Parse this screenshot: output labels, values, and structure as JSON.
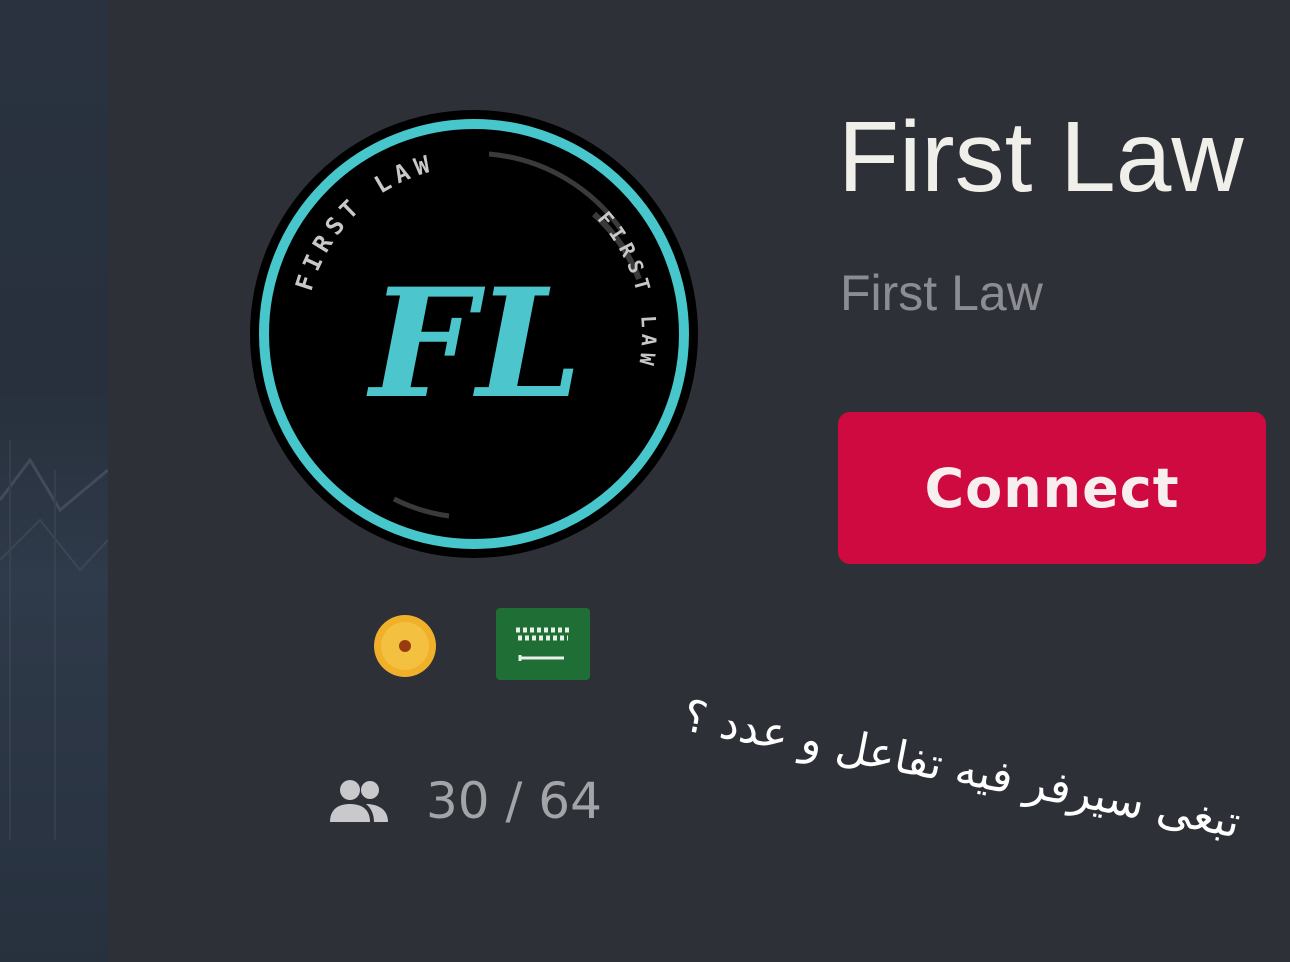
{
  "server": {
    "title": "First Law",
    "subtitle": "First Law",
    "logo_text": "FL",
    "logo_ring_text": "FIRST LAW"
  },
  "actions": {
    "connect_label": "Connect"
  },
  "badges": {
    "coin_icon": "gold-coin-icon",
    "flag_icon": "saudi-flag-icon"
  },
  "players": {
    "icon": "players-icon",
    "count": "30 / 64"
  },
  "caption": {
    "text": "تبغى سيرفر فيه تفاعل و عدد ؟"
  },
  "colors": {
    "background": "#2e3037",
    "accent": "#cf0a41",
    "logo_ring": "#47c6cc",
    "title": "#f1efea",
    "subtitle": "#8b8d92"
  }
}
